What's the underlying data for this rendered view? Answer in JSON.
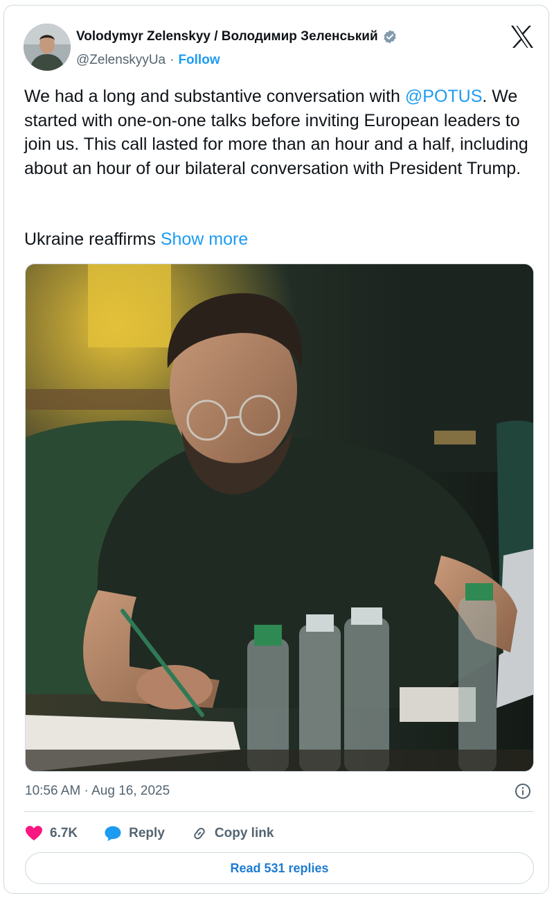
{
  "author": {
    "display_name": "Volodymyr Zelenskyy / Володимир Зеленський",
    "handle": "@ZelenskyyUa",
    "separator": "·",
    "follow_label": "Follow",
    "verified": true
  },
  "tweet": {
    "text_before_mention": "We had a long and substantive conversation with ",
    "mention": "@POTUS",
    "text_after_mention": ". We started with one-on-one talks before inviting European leaders to join us. This call lasted for more than an hour and a half, including about an hour of our bilateral conversation with President Trump.",
    "truncated_text": "Ukraine reaffirms ",
    "show_more_label": "Show more"
  },
  "timestamp": "10:56 AM · Aug 16, 2025",
  "actions": {
    "likes_count": "6.7K",
    "reply_label": "Reply",
    "copy_link_label": "Copy link"
  },
  "read_replies_label": "Read 531 replies",
  "colors": {
    "accent": "#1d9bf0",
    "like": "#f91880",
    "muted": "#536471",
    "border": "#cfd9de"
  },
  "icons": [
    "verified-badge-icon",
    "x-logo-icon",
    "info-icon",
    "heart-icon",
    "reply-bubble-icon",
    "link-icon"
  ]
}
